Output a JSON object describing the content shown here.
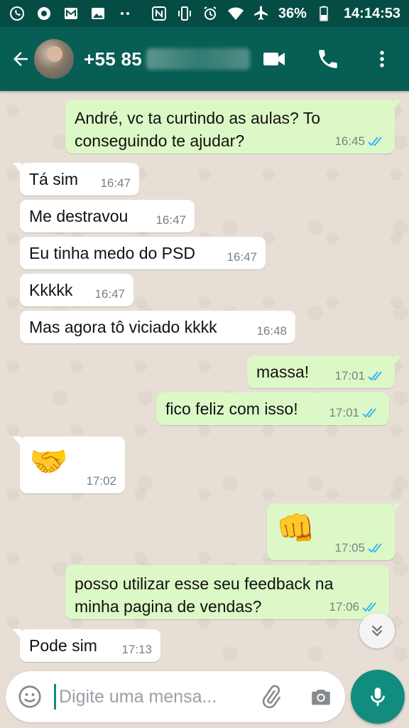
{
  "status_bar": {
    "battery": "36%",
    "time": "14:14:53",
    "icons": [
      "whatsapp-icon",
      "sync-icon",
      "mail-icon",
      "image-icon",
      "dots-icon",
      "nfc-icon",
      "vibrate-icon",
      "alarm-icon",
      "wifi-icon",
      "airplane-icon",
      "battery-icon"
    ]
  },
  "header": {
    "contact_prefix": "+55 85",
    "icons": [
      "back-arrow-icon",
      "video-call-icon",
      "phone-icon",
      "more-vert-icon"
    ]
  },
  "messages": [
    {
      "dir": "out",
      "lines": [
        "André, vc ta curtindo as aulas? To",
        "conseguindo te ajudar?"
      ],
      "time": "16:45",
      "read": true
    },
    {
      "dir": "in",
      "lines": [
        "Tá sim"
      ],
      "time": "16:47"
    },
    {
      "dir": "in",
      "lines": [
        "Me destravou"
      ],
      "time": "16:47"
    },
    {
      "dir": "in",
      "lines": [
        "Eu tinha medo do PSD"
      ],
      "time": "16:47"
    },
    {
      "dir": "in",
      "lines": [
        "Kkkkk"
      ],
      "time": "16:47"
    },
    {
      "dir": "in",
      "lines": [
        "Mas agora tô viciado kkkk"
      ],
      "time": "16:48"
    },
    {
      "dir": "out",
      "lines": [
        "massa!"
      ],
      "time": "17:01",
      "read": true
    },
    {
      "dir": "out",
      "lines": [
        "fico feliz com isso!"
      ],
      "time": "17:01",
      "read": true
    },
    {
      "dir": "in",
      "emoji": "🤝",
      "time": "17:02"
    },
    {
      "dir": "out",
      "emoji": "👊",
      "time": "17:05",
      "read": true
    },
    {
      "dir": "out",
      "lines": [
        "posso utilizar esse seu feedback na",
        "minha pagina de vendas?"
      ],
      "time": "17:06",
      "read": true
    },
    {
      "dir": "in",
      "lines": [
        "Pode sim"
      ],
      "time": "17:13"
    }
  ],
  "input": {
    "placeholder": "Digite uma mensa..."
  },
  "colors": {
    "header": "#075e54",
    "status_bar": "#054d44",
    "outgoing_bubble": "#dcf8c6",
    "incoming_bubble": "#ffffff",
    "read_ticks": "#34b7f1",
    "accent": "#128c7e"
  }
}
